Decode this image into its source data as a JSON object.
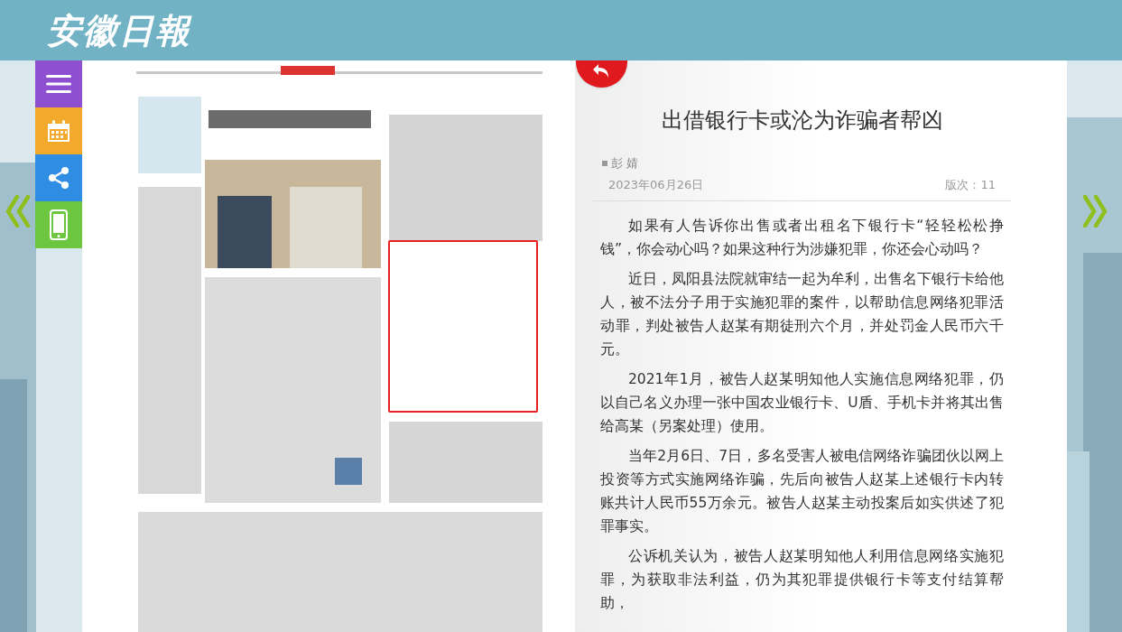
{
  "masthead": {
    "logo": "安徽日報"
  },
  "side_menu": [
    {
      "kind": "menu"
    },
    {
      "kind": "calendar"
    },
    {
      "kind": "share"
    },
    {
      "kind": "mobile"
    }
  ],
  "article": {
    "title": "出借银行卡或沦为诈骗者帮凶",
    "author": "彭 婧",
    "date": "2023年06月26日",
    "edition": "版次：11",
    "paragraphs": [
      "如果有人告诉你出售或者出租名下银行卡“轻轻松松挣钱”，你会动心吗？如果这种行为涉嫌犯罪，你还会心动吗？",
      "近日，凤阳县法院就审结一起为牟利，出售名下银行卡给他人，被不法分子用于实施犯罪的案件，以帮助信息网络犯罪活动罪，判处被告人赵某有期徒刑六个月，并处罚金人民币六千元。",
      "2021年1月，被告人赵某明知他人实施信息网络犯罪，仍以自己名义办理一张中国农业银行卡、U盾、手机卡并将其出售给高某（另案处理）使用。",
      "当年2月6日、7日，多名受害人被电信网络诈骗团伙以网上投资等方式实施网络诈骗，先后向被告人赵某上述银行卡内转账共计人民币55万余元。被告人赵某主动投案后如实供述了犯罪事实。",
      "公诉机关认为，被告人赵某明知他人利用信息网络实施犯罪，为获取非法利益，仍为其犯罪提供银行卡等支付结算帮助，"
    ]
  }
}
